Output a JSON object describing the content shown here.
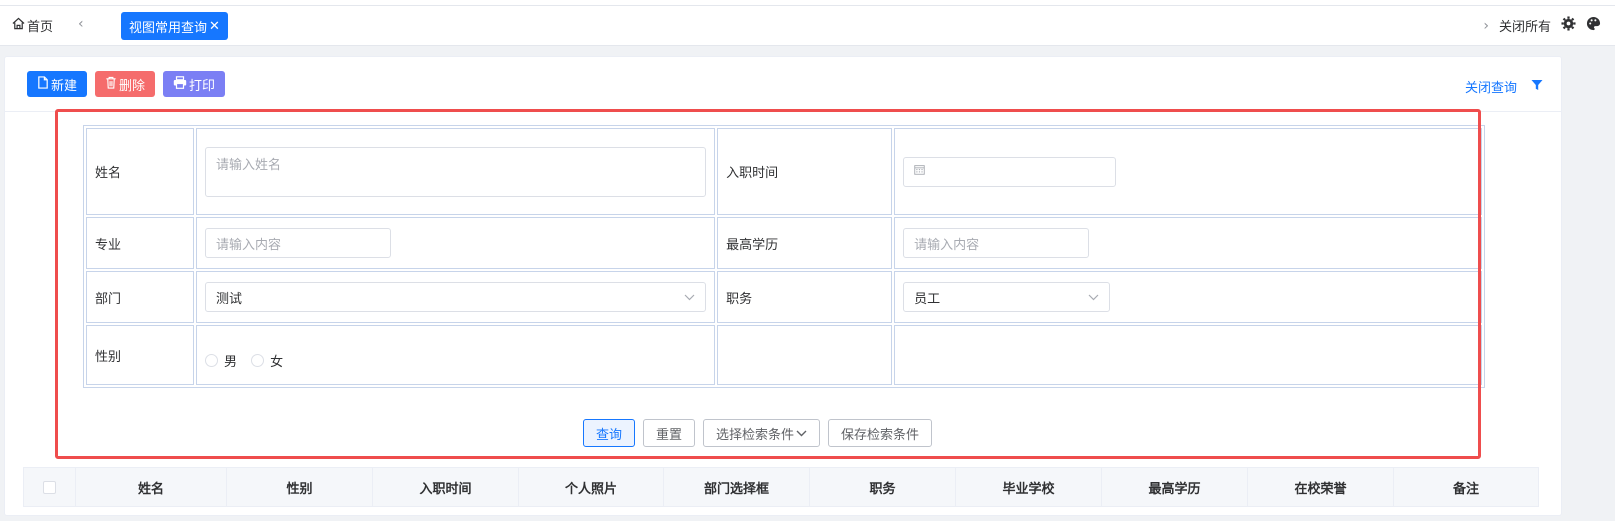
{
  "tabbar": {
    "home_label": "首页",
    "active_tab_label": "视图常用查询",
    "close_all_label": "关闭所有"
  },
  "toolbar": {
    "new_label": "新建",
    "delete_label": "删除",
    "print_label": "打印",
    "close_query_label": "关闭查询"
  },
  "form": {
    "name_label": "姓名",
    "name_placeholder": "请输入姓名",
    "hire_time_label": "入职时间",
    "major_label": "专业",
    "major_placeholder": "请输入内容",
    "education_label": "最高学历",
    "education_placeholder": "请输入内容",
    "dept_label": "部门",
    "dept_value": "测试",
    "position_label": "职务",
    "position_value": "员工",
    "gender_label": "性别",
    "gender_options": [
      "男",
      "女"
    ]
  },
  "query_buttons": {
    "search": "查询",
    "reset": "重置",
    "choose_conditions": "选择检索条件",
    "save_conditions": "保存检索条件"
  },
  "table": {
    "columns": [
      "姓名",
      "性别",
      "入职时间",
      "个人照片",
      "部门选择框",
      "职务",
      "毕业学校",
      "最高学历",
      "在校荣誉",
      "备注"
    ]
  },
  "colors": {
    "primary": "#1677ff",
    "danger": "#f56c6c",
    "print": "#7b7ff4",
    "highlight": "#ef4d4d"
  }
}
